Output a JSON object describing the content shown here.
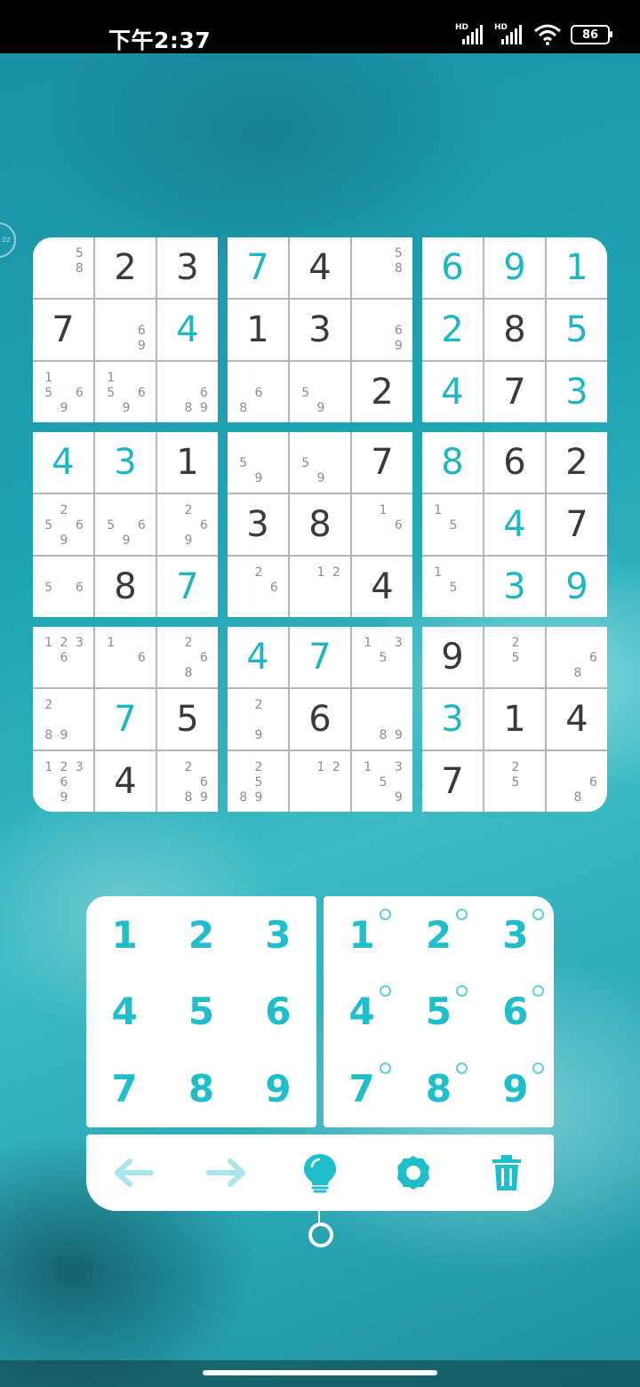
{
  "status_bar": {
    "time": "下午2:37",
    "signal1_label": "HD",
    "signal2_label": "HD",
    "battery": "86"
  },
  "edge_handle_label": "zz",
  "board": {
    "boxes": [
      [
        {
          "v": "",
          "t": "",
          "n": [
            "5",
            "8"
          ],
          "pos": [
            2,
            5
          ]
        },
        {
          "v": "2",
          "t": "given"
        },
        {
          "v": "3",
          "t": "given"
        },
        {
          "v": "7",
          "t": "given"
        },
        {
          "v": "",
          "n": [
            "6",
            "9"
          ],
          "pos": [
            5,
            8
          ]
        },
        {
          "v": "4",
          "t": "user"
        },
        {
          "v": "",
          "n": [
            "1",
            "5",
            "6",
            "9"
          ],
          "pos": [
            0,
            3,
            5,
            7
          ]
        },
        {
          "v": "",
          "n": [
            "1",
            "5",
            "6",
            "9"
          ],
          "pos": [
            0,
            3,
            5,
            7
          ]
        },
        {
          "v": "",
          "n": [
            "6",
            "8",
            "9"
          ],
          "pos": [
            5,
            7,
            8
          ]
        }
      ],
      [
        {
          "v": "7",
          "t": "user"
        },
        {
          "v": "4",
          "t": "given"
        },
        {
          "v": "",
          "n": [
            "5",
            "8"
          ],
          "pos": [
            2,
            5
          ]
        },
        {
          "v": "1",
          "t": "given"
        },
        {
          "v": "3",
          "t": "given"
        },
        {
          "v": "",
          "n": [
            "6",
            "9"
          ],
          "pos": [
            5,
            8
          ]
        },
        {
          "v": "",
          "n": [
            "6",
            "8"
          ],
          "pos": [
            4,
            6
          ]
        },
        {
          "v": "",
          "n": [
            "5",
            "9"
          ],
          "pos": [
            3,
            7
          ]
        },
        {
          "v": "2",
          "t": "given"
        }
      ],
      [
        {
          "v": "6",
          "t": "user"
        },
        {
          "v": "9",
          "t": "user"
        },
        {
          "v": "1",
          "t": "user"
        },
        {
          "v": "2",
          "t": "user"
        },
        {
          "v": "8",
          "t": "given"
        },
        {
          "v": "5",
          "t": "user"
        },
        {
          "v": "4",
          "t": "user"
        },
        {
          "v": "7",
          "t": "given"
        },
        {
          "v": "3",
          "t": "user"
        }
      ],
      [
        {
          "v": "4",
          "t": "user"
        },
        {
          "v": "3",
          "t": "user"
        },
        {
          "v": "1",
          "t": "given"
        },
        {
          "v": "",
          "n": [
            "2",
            "5",
            "6",
            "9"
          ],
          "pos": [
            1,
            3,
            5,
            7
          ]
        },
        {
          "v": "",
          "n": [
            "5",
            "6",
            "9"
          ],
          "pos": [
            3,
            5,
            7
          ]
        },
        {
          "v": "",
          "n": [
            "2",
            "6",
            "9"
          ],
          "pos": [
            1,
            5,
            7
          ]
        },
        {
          "v": "",
          "n": [
            "5",
            "6"
          ],
          "pos": [
            3,
            5
          ]
        },
        {
          "v": "8",
          "t": "given"
        },
        {
          "v": "7",
          "t": "user"
        }
      ],
      [
        {
          "v": "",
          "n": [
            "5",
            "9"
          ],
          "pos": [
            3,
            7
          ]
        },
        {
          "v": "",
          "n": [
            "5",
            "9"
          ],
          "pos": [
            3,
            7
          ]
        },
        {
          "v": "7",
          "t": "given"
        },
        {
          "v": "3",
          "t": "given"
        },
        {
          "v": "8",
          "t": "given"
        },
        {
          "v": "",
          "n": [
            "1",
            "6"
          ],
          "pos": [
            1,
            5
          ]
        },
        {
          "v": "",
          "n": [
            "2",
            "6"
          ],
          "pos": [
            1,
            5
          ]
        },
        {
          "v": "",
          "n": [
            "1",
            "2"
          ],
          "pos": [
            1,
            2
          ]
        },
        {
          "v": "4",
          "t": "given"
        }
      ],
      [
        {
          "v": "8",
          "t": "user"
        },
        {
          "v": "6",
          "t": "given"
        },
        {
          "v": "2",
          "t": "given"
        },
        {
          "v": "",
          "n": [
            "1",
            "5"
          ],
          "pos": [
            0,
            4
          ]
        },
        {
          "v": "4",
          "t": "user"
        },
        {
          "v": "7",
          "t": "given"
        },
        {
          "v": "",
          "n": [
            "1",
            "5"
          ],
          "pos": [
            0,
            4
          ]
        },
        {
          "v": "3",
          "t": "user"
        },
        {
          "v": "9",
          "t": "user"
        }
      ],
      [
        {
          "v": "",
          "n": [
            "1",
            "2",
            "3",
            "6"
          ],
          "pos": [
            0,
            1,
            2,
            4
          ]
        },
        {
          "v": "",
          "n": [
            "1",
            "6"
          ],
          "pos": [
            0,
            5
          ]
        },
        {
          "v": "",
          "n": [
            "2",
            "6",
            "8"
          ],
          "pos": [
            1,
            5,
            7
          ]
        },
        {
          "v": "",
          "n": [
            "2",
            "8",
            "9"
          ],
          "pos": [
            0,
            6,
            7
          ]
        },
        {
          "v": "7",
          "t": "user"
        },
        {
          "v": "5",
          "t": "given"
        },
        {
          "v": "",
          "n": [
            "1",
            "2",
            "3",
            "6",
            "9"
          ],
          "pos": [
            0,
            1,
            2,
            4,
            7
          ]
        },
        {
          "v": "4",
          "t": "given"
        },
        {
          "v": "",
          "n": [
            "2",
            "6",
            "8",
            "9"
          ],
          "pos": [
            1,
            5,
            7,
            8
          ]
        }
      ],
      [
        {
          "v": "4",
          "t": "user"
        },
        {
          "v": "7",
          "t": "user"
        },
        {
          "v": "",
          "n": [
            "1",
            "3",
            "5"
          ],
          "pos": [
            0,
            2,
            4
          ]
        },
        {
          "v": "",
          "n": [
            "2",
            "9"
          ],
          "pos": [
            1,
            7
          ]
        },
        {
          "v": "6",
          "t": "given"
        },
        {
          "v": "",
          "n": [
            "8",
            "9"
          ],
          "pos": [
            7,
            8
          ]
        },
        {
          "v": "",
          "n": [
            "2",
            "5",
            "8",
            "9"
          ],
          "pos": [
            1,
            4,
            6,
            7
          ]
        },
        {
          "v": "",
          "n": [
            "1",
            "2"
          ],
          "pos": [
            1,
            2
          ]
        },
        {
          "v": "",
          "n": [
            "1",
            "3",
            "5",
            "9"
          ],
          "pos": [
            0,
            2,
            4,
            8
          ]
        }
      ],
      [
        {
          "v": "9",
          "t": "given"
        },
        {
          "v": "",
          "n": [
            "2",
            "5"
          ],
          "pos": [
            1,
            4
          ]
        },
        {
          "v": "",
          "n": [
            "6",
            "8"
          ],
          "pos": [
            5,
            7
          ]
        },
        {
          "v": "3",
          "t": "user"
        },
        {
          "v": "1",
          "t": "given"
        },
        {
          "v": "4",
          "t": "given"
        },
        {
          "v": "7",
          "t": "given"
        },
        {
          "v": "",
          "n": [
            "2",
            "5"
          ],
          "pos": [
            1,
            4
          ]
        },
        {
          "v": "",
          "n": [
            "6",
            "8"
          ],
          "pos": [
            5,
            7
          ]
        }
      ]
    ]
  },
  "number_pad": [
    "1",
    "2",
    "3",
    "4",
    "5",
    "6",
    "7",
    "8",
    "9"
  ],
  "notes_pad": [
    "1",
    "2",
    "3",
    "4",
    "5",
    "6",
    "7",
    "8",
    "9"
  ],
  "toolbar": {
    "icons": [
      "undo-arrow-icon",
      "redo-arrow-icon",
      "hint-bulb-icon",
      "settings-gear-icon",
      "trash-icon"
    ],
    "accent_color": "#1fbecb",
    "faded_color": "#a8e6ec"
  },
  "colors": {
    "given_digit": "#3a3a3a",
    "user_digit": "#1fb6c4",
    "note_digit": "#8d8d8d"
  }
}
